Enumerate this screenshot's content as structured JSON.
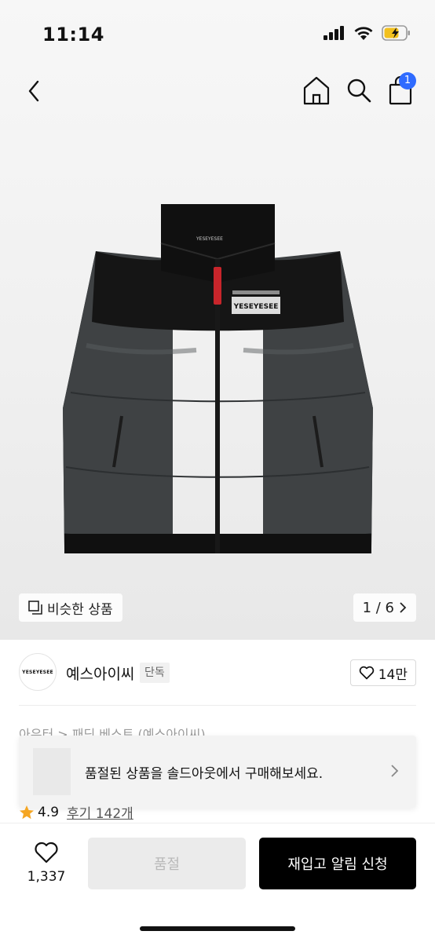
{
  "status": {
    "time": "11:14"
  },
  "nav": {
    "cart_count": "1"
  },
  "product": {
    "logo_text": "YESEYESEE",
    "similar_label": "비슷한 상품",
    "page_indicator": "1 / 6"
  },
  "brand": {
    "logo_text": "YESEYESEE",
    "name": "예스아이씨",
    "tag": "단독",
    "likes": "14만"
  },
  "breadcrumb": "아우터 > 패딩 베스트 (예스아이씨)",
  "banner": {
    "text": "품절된 상품을 솔드아웃에서 구매해보세요."
  },
  "rating": {
    "score": "4.9",
    "reviews": "후기 142개"
  },
  "bottom": {
    "wish_count": "1,337",
    "soldout_label": "품절",
    "restock_label": "재입고 알림 신청"
  },
  "colors": {
    "accent_blue": "#2f6bff",
    "star": "#f5a623",
    "primary_button": "#000000"
  }
}
